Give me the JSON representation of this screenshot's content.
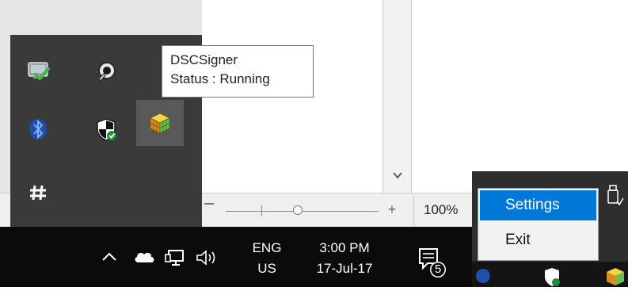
{
  "tooltip": {
    "title": "DSCSigner",
    "status": "Status : Running"
  },
  "tray_overflow": {
    "icons": [
      {
        "name": "windows-update-icon",
        "color": "#43b649"
      },
      {
        "name": "speaker-icon",
        "color": "#cfcfcf"
      },
      {
        "name": "bluetooth-icon",
        "color": "#2f6fd6"
      },
      {
        "name": "defender-shield-icon",
        "color": "#ffffff"
      },
      {
        "name": "dscsigner-cube-icon",
        "color": "#e6b800"
      },
      {
        "name": "hash-icon",
        "color": "#ffffff"
      }
    ]
  },
  "document": {
    "zoom_level": "100%"
  },
  "taskbar": {
    "language_primary": "ENG",
    "language_secondary": "US",
    "time": "3:00 PM",
    "date": "17-Jul-17",
    "notification_count": "5"
  },
  "context_menu": {
    "items": [
      {
        "label": "Settings",
        "selected": true
      },
      {
        "label": "Exit",
        "selected": false
      }
    ]
  },
  "colors": {
    "taskbar": "#0b0b0b",
    "overflow_panel": "#3a3a3a",
    "menu_highlight": "#0078d7"
  }
}
